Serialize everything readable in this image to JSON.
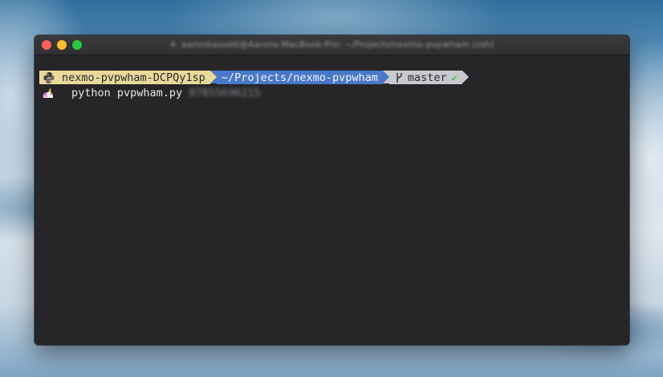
{
  "window": {
    "title": "4. aaronbassett@Aarons-MacBook-Pro: ~/Projects/nexmo-pvpwham (zsh)"
  },
  "prompt": {
    "env": "nexmo-pvpwham-DCPQy1sp",
    "path": "~/Projects/nexmo-pvpwham",
    "branch": "master",
    "branch_icon": "git-branch-icon",
    "status_icon": "check-icon",
    "status_glyph": "✔"
  },
  "command": {
    "text": "python pvpwham.py",
    "arg": "07855696215"
  },
  "colors": {
    "env_segment": "#e9d89a",
    "path_segment": "#4a78c9",
    "git_segment": "#c8c9ce",
    "terminal_bg": "#262528"
  }
}
